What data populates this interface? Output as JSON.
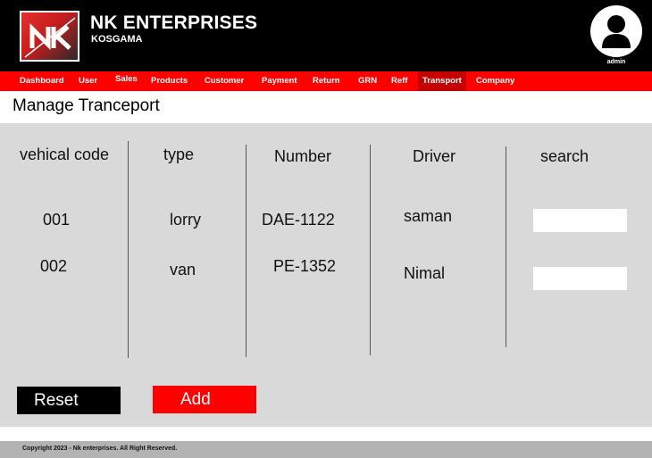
{
  "header": {
    "brand_name": "NK ENTERPRISES",
    "brand_sub": "KOSGAMA",
    "user_label": "admin"
  },
  "nav": {
    "items": [
      "Dashboard",
      "User",
      "Sales",
      "Products",
      "Customer",
      "Payment",
      "Return",
      "GRN",
      "Reff",
      "Transport",
      "Company"
    ],
    "active": "Transport"
  },
  "page_title": "Manage Tranceport",
  "table": {
    "columns": [
      "vehical code",
      "type",
      "Number",
      "Driver",
      "search"
    ],
    "rows": [
      {
        "code": "001",
        "type": "lorry",
        "number": "DAE-1122",
        "driver": "saman"
      },
      {
        "code": "002",
        "type": "van",
        "number": "PE-1352",
        "driver": "Nimal"
      }
    ]
  },
  "buttons": {
    "reset": "Reset",
    "add": "Add"
  },
  "footer": {
    "text": "Copyright 2023 - Nk enterprises. All Right Reserved."
  },
  "colors": {
    "header_bg": "#000000",
    "nav_bg": "#ff0000",
    "nav_active_bg": "#c40000",
    "content_bg": "#d9d9d9",
    "footer_bg": "#b3b3b3"
  }
}
